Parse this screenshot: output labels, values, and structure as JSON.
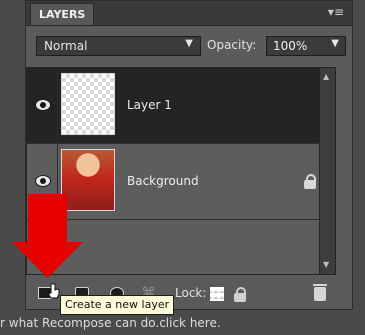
{
  "panel": {
    "tab_label": "LAYERS",
    "menu_glyph": "▾≡",
    "blend_mode": "Normal",
    "opacity_label": "Opacity:",
    "opacity_value": "100%"
  },
  "layers": [
    {
      "name": "Layer 1",
      "selected": true,
      "visible": true,
      "thumbnail": "transparent"
    },
    {
      "name": "Background",
      "selected": false,
      "visible": true,
      "thumbnail": "photo",
      "locked": true
    }
  ],
  "toolbar": {
    "lock_label": "Lock:",
    "icons": [
      "new-layer-icon",
      "mask-icon",
      "adjustment-icon",
      "link-icon",
      "lock-transparent-icon",
      "lock-all-icon",
      "trash-icon"
    ]
  },
  "tooltip": {
    "text": "Create a new layer"
  },
  "background_hint": "r what Recompose can do.click here.",
  "colors": {
    "panel_bg": "#5b5b5b",
    "header_bg": "#3a3a3a",
    "selected_row": "#242424",
    "arrow_red": "#e60000",
    "tooltip_bg": "#fffad8"
  }
}
